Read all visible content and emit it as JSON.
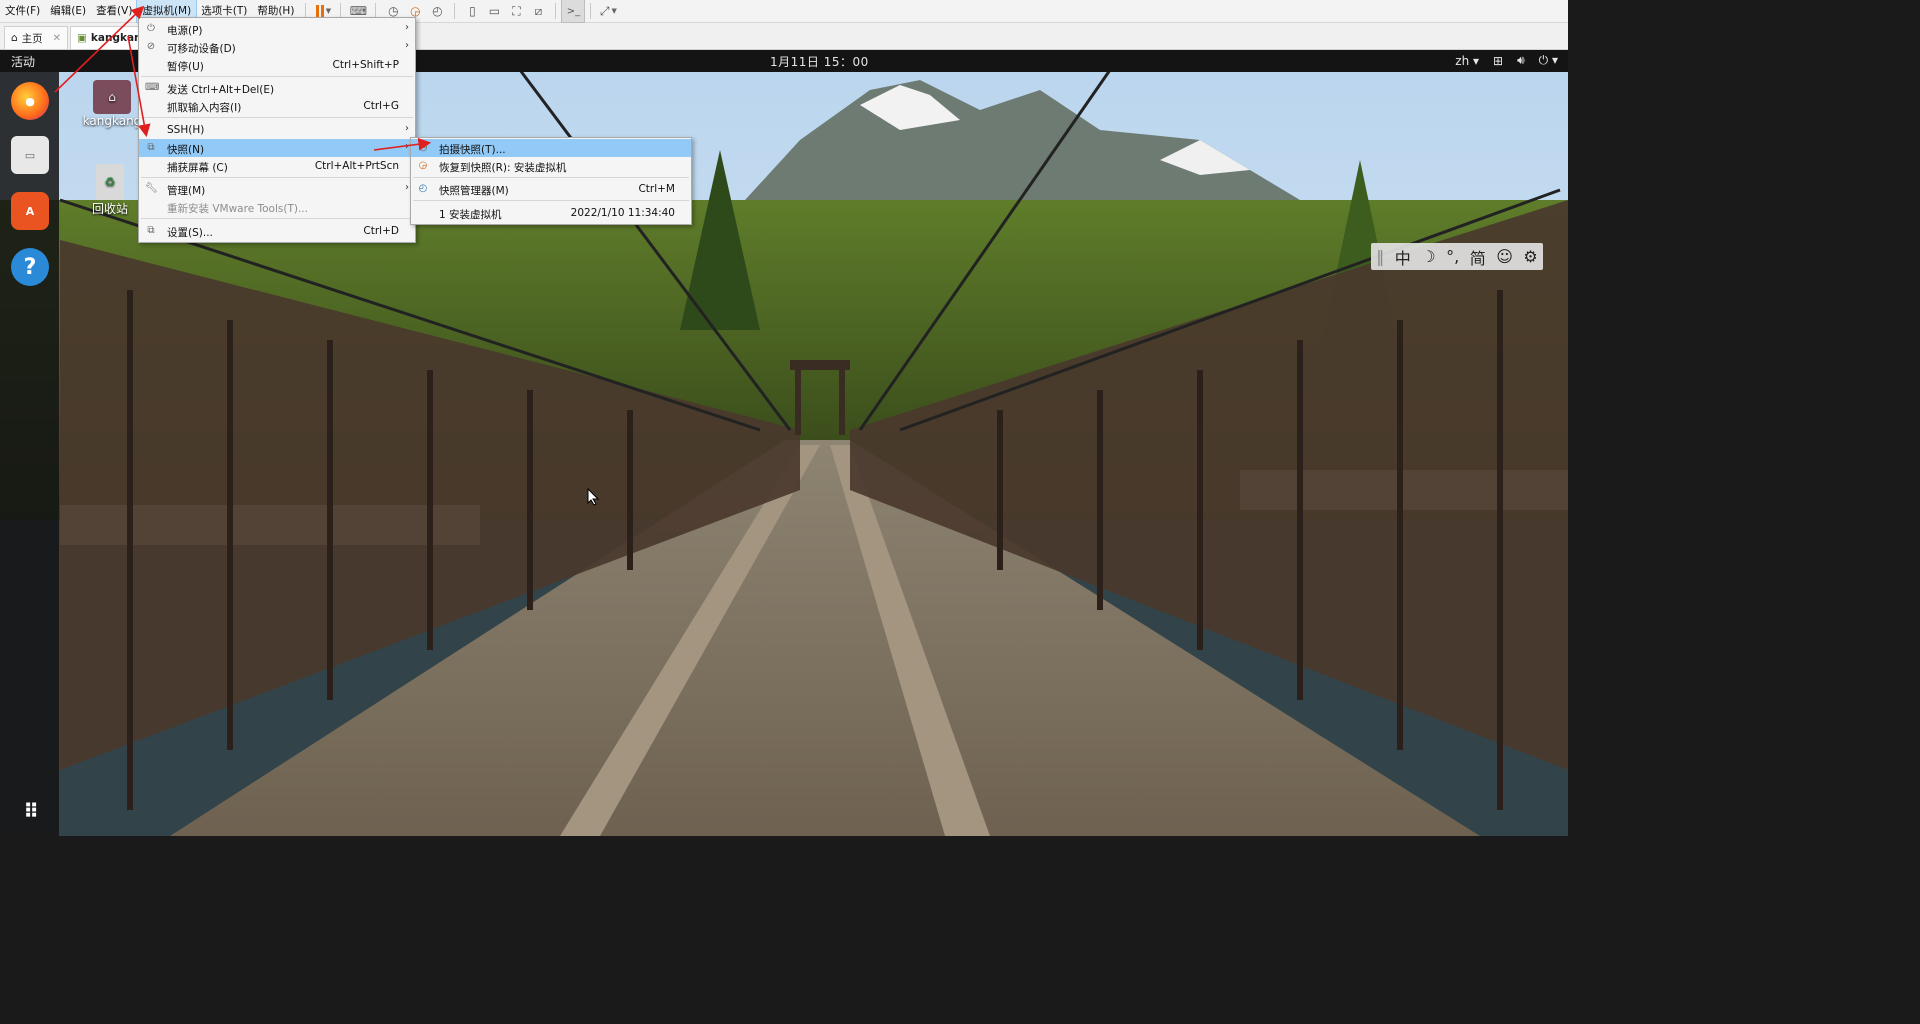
{
  "menubar": {
    "items": [
      "文件(F)",
      "编辑(E)",
      "查看(V)",
      "虚拟机(M)",
      "选项卡(T)",
      "帮助(H)"
    ],
    "active": "虚拟机(M)"
  },
  "tabs": [
    {
      "label": "主页"
    },
    {
      "label": "kangkang"
    }
  ],
  "vm_menu": {
    "items": [
      {
        "label": "电源(P)",
        "shortcut": "",
        "submenu": true,
        "icon": "power-icon"
      },
      {
        "label": "可移动设备(D)",
        "shortcut": "",
        "submenu": true,
        "icon": "removable-device-icon"
      },
      {
        "label": "暂停(U)",
        "shortcut": "Ctrl+Shift+P",
        "submenu": false,
        "icon": ""
      },
      {
        "label": "发送 Ctrl+Alt+Del(E)",
        "shortcut": "",
        "submenu": false,
        "icon": "keyboard-icon"
      },
      {
        "label": "抓取输入内容(I)",
        "shortcut": "Ctrl+G",
        "submenu": false,
        "icon": ""
      },
      {
        "label": "SSH(H)",
        "shortcut": "",
        "submenu": true,
        "icon": ""
      },
      {
        "label": "快照(N)",
        "shortcut": "",
        "submenu": true,
        "icon": "snapshot-icon",
        "highlighted": true
      },
      {
        "label": "捕获屏幕 (C)",
        "shortcut": "Ctrl+Alt+PrtScn",
        "submenu": false,
        "icon": ""
      },
      {
        "label": "管理(M)",
        "shortcut": "",
        "submenu": true,
        "icon": "wrench-icon"
      },
      {
        "label": "重新安装 VMware Tools(T)...",
        "shortcut": "",
        "submenu": false,
        "icon": "",
        "disabled": true
      },
      {
        "label": "设置(S)...",
        "shortcut": "Ctrl+D",
        "submenu": false,
        "icon": "settings-icon"
      }
    ]
  },
  "snapshot_menu": {
    "items": [
      {
        "label": "拍摄快照(T)...",
        "shortcut": "",
        "highlighted": true,
        "icon": "take-snapshot-icon"
      },
      {
        "label": "恢复到快照(R): 安装虚拟机",
        "shortcut": "",
        "icon": "revert-snapshot-icon"
      },
      {
        "label": "快照管理器(M)",
        "shortcut": "Ctrl+M",
        "icon": "snapshot-manager-icon"
      },
      {
        "label": "1   安装虚拟机",
        "shortcut": "2022/1/10 11:34:40",
        "icon": ""
      }
    ]
  },
  "guest": {
    "activities": "活动",
    "clock": "1月11日  15：00",
    "lang": "zh",
    "desktop_icons": [
      {
        "label": "kangkang",
        "icon": "home-folder-icon"
      },
      {
        "label": "回收站",
        "icon": "trash-icon"
      }
    ],
    "dock": [
      "firefox-icon",
      "files-icon",
      "software-center-icon",
      "help-icon",
      "app-grid-icon"
    ],
    "ime": [
      "中",
      "☽",
      "°,",
      "简",
      "☺",
      "⚙"
    ]
  }
}
